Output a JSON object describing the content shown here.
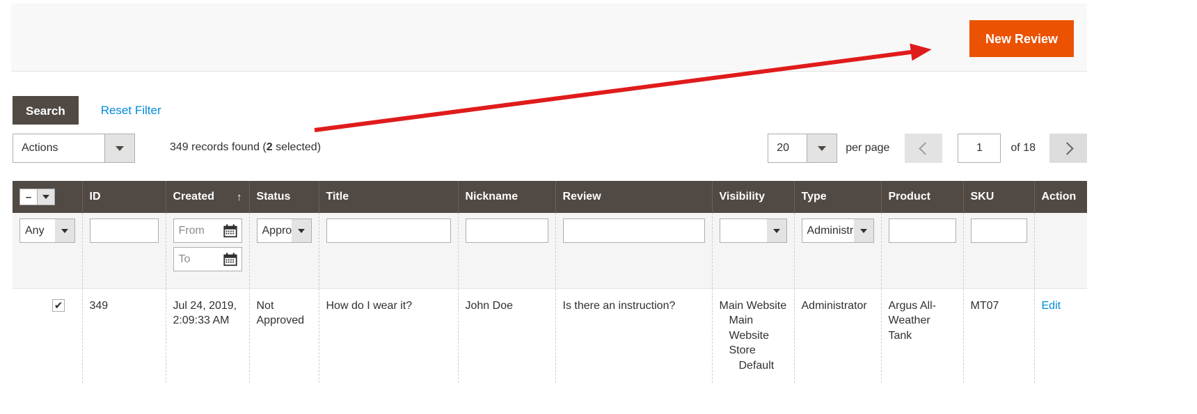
{
  "header": {
    "new_review_label": "New Review"
  },
  "toolbar": {
    "search_label": "Search",
    "reset_filter_label": "Reset Filter",
    "actions_label": "Actions",
    "records_found_prefix": "349 records found (",
    "records_selected_count": "2",
    "records_found_suffix": " selected)"
  },
  "pagination": {
    "per_page_value": "20",
    "per_page_label": "per page",
    "current_page": "1",
    "of_label": "of 18",
    "prev_icon": "chevron-left-icon",
    "next_icon": "chevron-right-icon"
  },
  "grid": {
    "massaction": {
      "dash": "–",
      "caret_icon": "chevron-down-icon"
    },
    "columns": [
      {
        "key": "massaction",
        "label": ""
      },
      {
        "key": "id",
        "label": "ID"
      },
      {
        "key": "created",
        "label": "Created",
        "sorted": true,
        "sort_icon": "↑"
      },
      {
        "key": "status",
        "label": "Status"
      },
      {
        "key": "title",
        "label": "Title"
      },
      {
        "key": "nickname",
        "label": "Nickname"
      },
      {
        "key": "review",
        "label": "Review"
      },
      {
        "key": "visibility",
        "label": "Visibility"
      },
      {
        "key": "type",
        "label": "Type"
      },
      {
        "key": "product",
        "label": "Product"
      },
      {
        "key": "sku",
        "label": "SKU"
      },
      {
        "key": "action",
        "label": "Action"
      }
    ],
    "filters": {
      "massaction_select": "Any",
      "id_value": "",
      "created_from_placeholder": "From",
      "created_to_placeholder": "To",
      "status_select": "Appro",
      "title_value": "",
      "nickname_value": "",
      "review_value": "",
      "visibility_select": "",
      "type_select": "Administr",
      "product_value": "",
      "sku_value": "",
      "calendar_icon": "calendar-icon"
    },
    "rows": [
      {
        "checked": true,
        "check_glyph": "✔",
        "id": "349",
        "created": "Jul 24, 2019, 2:09:33 AM",
        "status": "Not Approved",
        "title": "How do I wear it?",
        "nickname": "John Doe",
        "review": "Is there an instruction?",
        "visibility_l1": "Main Website",
        "visibility_l2": "Main Website Store",
        "visibility_l3": "Default",
        "type": "Administrator",
        "product": "Argus All-Weather Tank",
        "sku": "MT07",
        "action": "Edit"
      }
    ]
  },
  "annotation": {
    "arrow_color": "#e01b1b"
  },
  "colors": {
    "accent_orange": "#eb5202",
    "header_brown": "#514943",
    "link_blue": "#008bdb"
  }
}
